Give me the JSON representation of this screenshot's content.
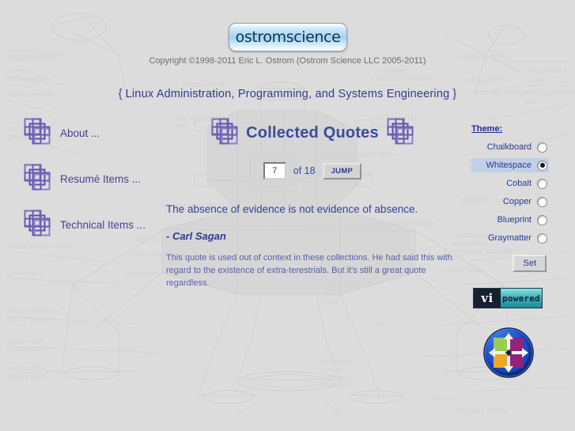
{
  "page": {
    "background_color": "#dcdcdc",
    "watermark": "apollo-lunar-module-blueprint"
  },
  "header": {
    "logo_text": "ostromscience",
    "copyright": "Copyright ©1998-2011  Eric L. Ostrom (Ostrom Science LLC 2005-2011)",
    "tagline_open_brace": "{",
    "tagline": "Linux Administration, Programming, and Systems Engineering",
    "tagline_close_brace": "}",
    "accent_color": "#333b8f"
  },
  "sidebar": {
    "items": [
      {
        "label": "About ...",
        "icon": "stacked-squares-icon"
      },
      {
        "label": "Resumé Items ...",
        "icon": "stacked-squares-icon"
      },
      {
        "label": "Technical Items ...",
        "icon": "stacked-squares-icon"
      }
    ]
  },
  "main": {
    "title": "Collected Quotes",
    "title_icon_left": "stacked-squares-icon",
    "title_icon_right": "stacked-squares-icon",
    "pager": {
      "page_value": "7",
      "page_placeholder": "",
      "of_label": "of 18",
      "total_pages": 18,
      "jump_label": "JUMP"
    },
    "quote": {
      "text": "The absence of evidence is not evidence of absence.",
      "author": "- Carl Sagan",
      "note": "This quote is used out of context in these collections. He had said this with regard to the existence of extra-terestrials. But it's still a great quote regardless."
    },
    "title_color": "#3b4ba0",
    "quote_color": "#3b3f96"
  },
  "theme_panel": {
    "heading": "Theme:",
    "selected": "Whitespace",
    "options": [
      {
        "label": "Chalkboard",
        "checked": false
      },
      {
        "label": "Whitespace",
        "checked": true
      },
      {
        "label": "Cobalt",
        "checked": false
      },
      {
        "label": "Copper",
        "checked": false
      },
      {
        "label": "Blueprint",
        "checked": false
      },
      {
        "label": "Graymatter",
        "checked": false
      }
    ],
    "set_label": "Set",
    "highlight_color": "#c2cfe8"
  },
  "badges": {
    "vi_left": "vi",
    "vi_right": "powered",
    "os_logo": "centos-logo"
  }
}
